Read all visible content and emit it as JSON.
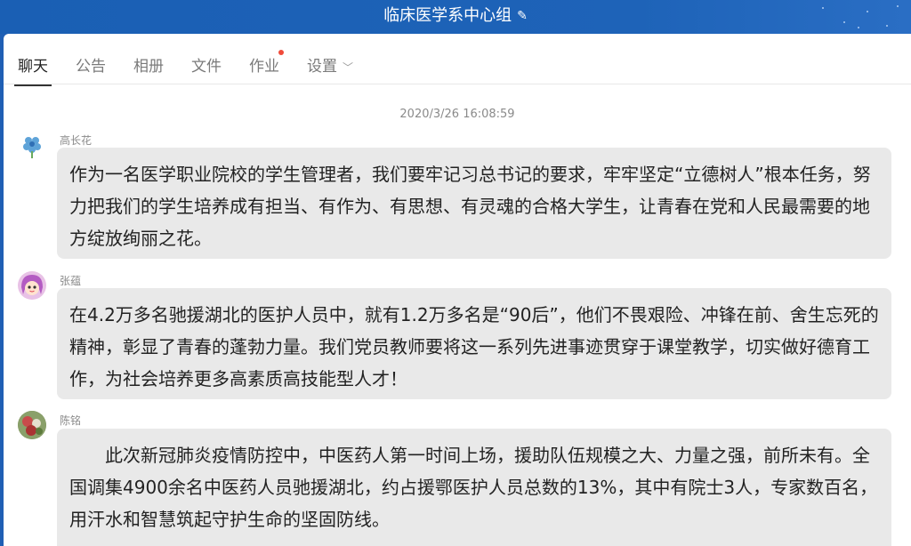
{
  "window": {
    "title": "临床医学系中心组"
  },
  "tabs": [
    {
      "label": "聊天",
      "active": true
    },
    {
      "label": "公告"
    },
    {
      "label": "相册"
    },
    {
      "label": "文件"
    },
    {
      "label": "作业",
      "badge": true
    },
    {
      "label": "设置"
    }
  ],
  "chat": {
    "timestamp": "2020/3/26 16:08:59",
    "messages": [
      {
        "sender": "高长花",
        "text": "作为一名医学职业院校的学生管理者，我们要牢记习总书记的要求，牢牢坚定“立德树人”根本任务，努力把我们的学生培养成有担当、有作为、有思想、有灵魂的合格大学生，让青春在党和人民最需要的地方绽放绚丽之花。"
      },
      {
        "sender": "张蕴",
        "text": "在4.2万多名驰援湖北的医护人员中，就有1.2万多名是“90后”，他们不畏艰险、冲锋在前、舍生忘死的精神，彰显了青春的蓬勃力量。我们党员教师要将这一系列先进事迹贯穿于课堂教学，切实做好德育工作，为社会培养更多高素质高技能型人才！"
      },
      {
        "sender": "陈铭",
        "text": "　　此次新冠肺炎疫情防控中，中医药人第一时间上场，援助队伍规模之大、力量之强，前所未有。全国调集4900余名中医药人员驰援湖北，约占援鄂医护人员总数的13%，其中有院士3人，专家数百名，用汗水和智慧筑起守护生命的坚固防线。"
      }
    ]
  },
  "colors": {
    "titlebar": "#1a5fb4",
    "bubble": "#e9e9e9",
    "badge": "#f04b3a"
  },
  "icons": [
    "edit-icon",
    "chevron-down-icon"
  ]
}
